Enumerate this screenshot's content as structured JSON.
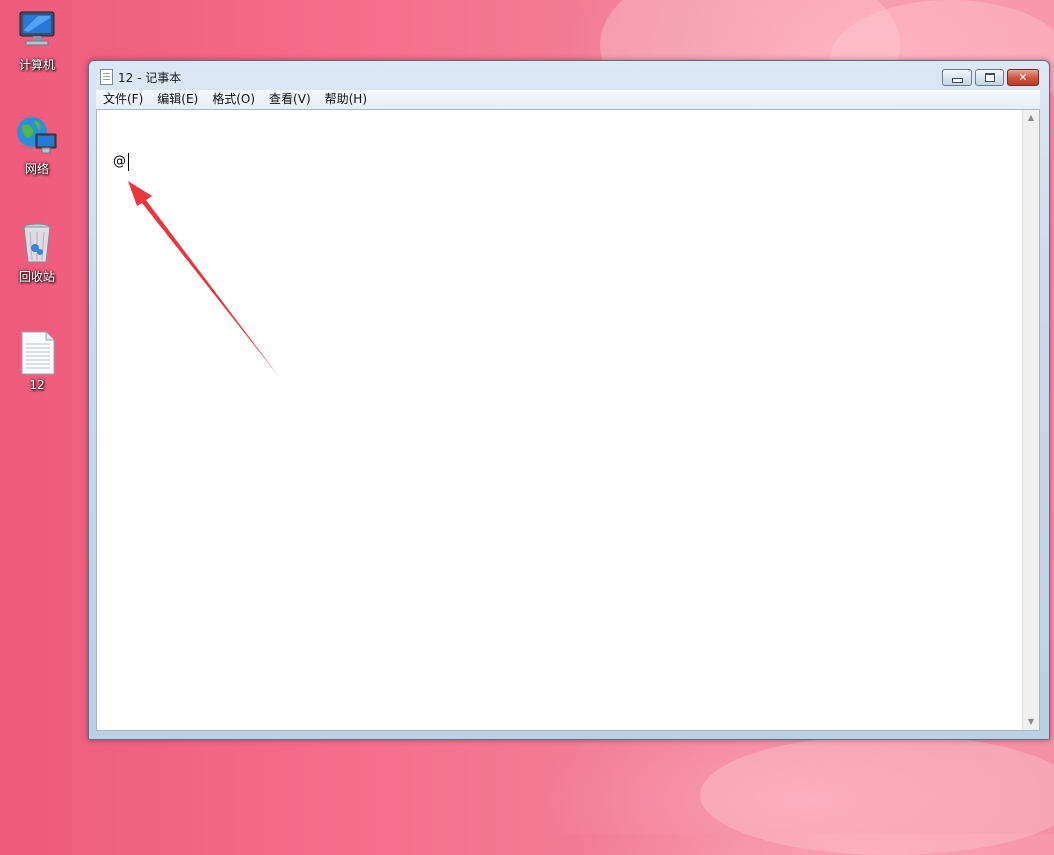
{
  "desktop": {
    "icons": [
      {
        "label": "计算机"
      },
      {
        "label": "网络"
      },
      {
        "label": "回收站"
      },
      {
        "label": "12"
      }
    ]
  },
  "window": {
    "title": "12 - 记事本",
    "controls": {
      "minimize": "",
      "maximize": "",
      "close": "✕"
    }
  },
  "menu": [
    {
      "label": "文件(F)"
    },
    {
      "label": "编辑(E)"
    },
    {
      "label": "格式(O)"
    },
    {
      "label": "查看(V)"
    },
    {
      "label": "帮助(H)"
    }
  ],
  "editor": {
    "content": "@"
  },
  "scrollbar": {
    "up": "▲",
    "down": "▼"
  },
  "annotation": {
    "color": "#e8373c"
  }
}
